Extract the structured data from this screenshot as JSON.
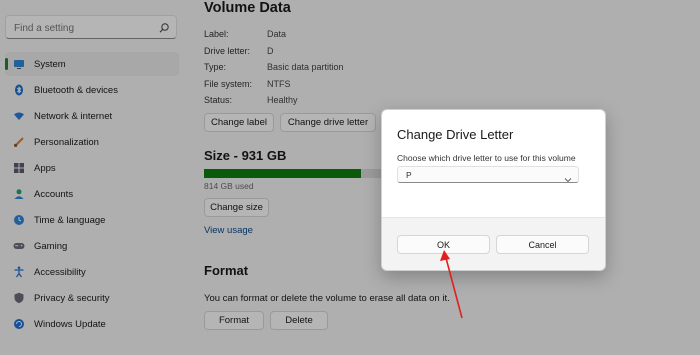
{
  "sidebar": {
    "search_placeholder": "Find a setting",
    "items": [
      {
        "label": "System",
        "icon": "display-icon",
        "active": true
      },
      {
        "label": "Bluetooth & devices",
        "icon": "bluetooth-icon"
      },
      {
        "label": "Network & internet",
        "icon": "wifi-icon"
      },
      {
        "label": "Personalization",
        "icon": "brush-icon"
      },
      {
        "label": "Apps",
        "icon": "apps-icon"
      },
      {
        "label": "Accounts",
        "icon": "person-icon"
      },
      {
        "label": "Time & language",
        "icon": "globe-clock-icon"
      },
      {
        "label": "Gaming",
        "icon": "gamepad-icon"
      },
      {
        "label": "Accessibility",
        "icon": "accessibility-icon"
      },
      {
        "label": "Privacy & security",
        "icon": "shield-icon"
      },
      {
        "label": "Windows Update",
        "icon": "update-icon"
      }
    ]
  },
  "volume": {
    "title": "Volume Data",
    "properties": [
      {
        "key": "Label:",
        "value": "Data"
      },
      {
        "key": "Drive letter:",
        "value": "D"
      },
      {
        "key": "Type:",
        "value": "Basic data partition"
      },
      {
        "key": "File system:",
        "value": "NTFS"
      },
      {
        "key": "Status:",
        "value": "Healthy"
      }
    ],
    "change_label_button": "Change label",
    "change_drive_letter_button": "Change drive letter"
  },
  "size": {
    "title": "Size - 931 GB",
    "used_text": "814 GB used",
    "used_fraction": 0.874,
    "change_size_button": "Change size",
    "view_usage_link": "View usage"
  },
  "format": {
    "title": "Format",
    "description": "You can format or delete the volume to erase all data on it.",
    "format_button": "Format",
    "delete_button": "Delete"
  },
  "dialog": {
    "title": "Change Drive Letter",
    "subtitle": "Choose which drive letter to use for this volume",
    "selected_letter": "P",
    "ok_button": "OK",
    "cancel_button": "Cancel"
  },
  "colors": {
    "accent_bar": "#2e7d32",
    "usage_fill": "#107c10",
    "annotation_arrow": "#e02020"
  }
}
